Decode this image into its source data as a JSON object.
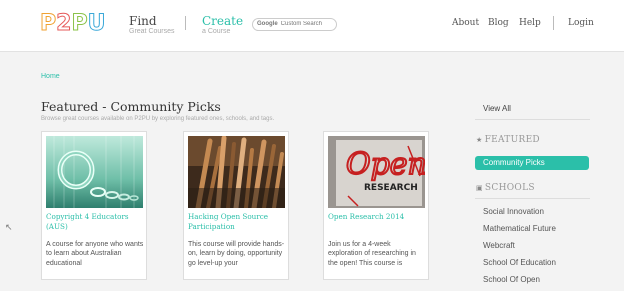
{
  "logo": {
    "p1": "P",
    "two": "2",
    "p2": "P",
    "u": "U"
  },
  "nav": {
    "find": {
      "title": "Find",
      "sub": "Great Courses"
    },
    "create": {
      "title": "Create",
      "sub": "a Course"
    },
    "search": {
      "brand": "Google",
      "placeholder": "Custom Search"
    },
    "links": [
      "About",
      "Blog",
      "Help",
      "Login"
    ]
  },
  "breadcrumb": "Home",
  "page": {
    "title": "Featured - Community Picks",
    "subtitle": "Browse great courses available on P2PU by exploring featured ones, schools, and tags."
  },
  "cards": [
    {
      "title": "Copyright 4 Educators (AUS)",
      "desc": "A course for anyone who wants to learn about Australian educational"
    },
    {
      "title": "Hacking Open Source Participation",
      "desc": "This course will provide hands-on, learn by doing, opportunity go level-up your"
    },
    {
      "title": "Open Research 2014",
      "desc": "Join us for a 4-week exploration of researching in the open! This course is",
      "thumb_text": {
        "line1": "Open",
        "line2": "RESEARCH"
      }
    }
  ],
  "sidebar": {
    "view_all": "View All",
    "featured_heading": "FEATURED",
    "active_item": "Community Picks",
    "schools_heading": "SCHOOLS",
    "schools": [
      "Social Innovation",
      "Mathematical Future",
      "Webcraft",
      "School Of Education",
      "School Of Open"
    ]
  },
  "colors": {
    "accent": "#2bbfa9",
    "background": "#f3f3f3"
  }
}
